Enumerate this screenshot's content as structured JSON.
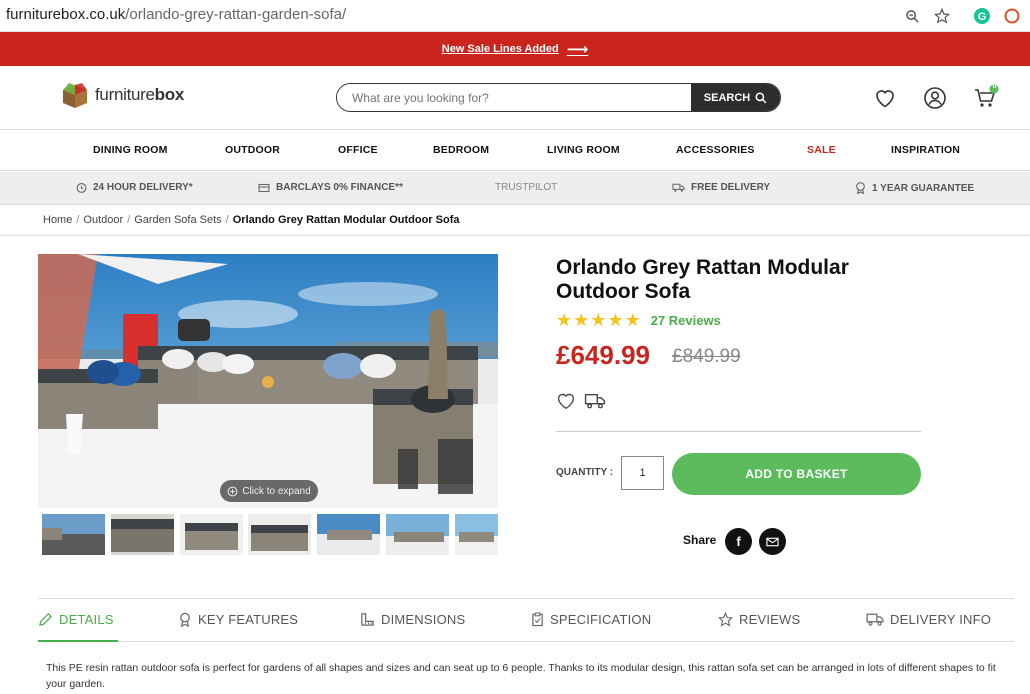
{
  "browser": {
    "url_domain": "furniturebox.co.uk",
    "url_path": "/orlando-grey-rattan-garden-sofa/"
  },
  "promo": {
    "text": "New Sale Lines Added"
  },
  "header": {
    "logo_light": "furniture",
    "logo_bold": "box",
    "search_placeholder": "What are you looking for?",
    "search_label": "SEARCH",
    "basket_count": "0"
  },
  "nav": [
    "DINING ROOM",
    "OUTDOOR",
    "OFFICE",
    "BEDROOM",
    "LIVING ROOM",
    "ACCESSORIES",
    "SALE",
    "INSPIRATION"
  ],
  "usp": [
    "24 HOUR DELIVERY*",
    "BARCLAYS 0% FINANCE**",
    "TRUSTPILOT",
    "FREE DELIVERY",
    "1 YEAR GUARANTEE"
  ],
  "breadcrumb": {
    "home": "Home",
    "outdoor": "Outdoor",
    "sets": "Garden Sofa Sets",
    "current": "Orlando Grey Rattan Modular Outdoor Sofa"
  },
  "gallery": {
    "expand_label": "Click to expand"
  },
  "product": {
    "title_line1": "Orlando Grey Rattan Modular",
    "title_line2": "Outdoor Sofa",
    "rating": 5,
    "reviews": "27 Reviews",
    "price": "£649.99",
    "old_price": "£849.99",
    "quantity_label": "QUANTITY :",
    "quantity": "1",
    "add_label": "ADD TO BASKET",
    "share_label": "Share"
  },
  "tabs": [
    "DETAILS",
    "KEY FEATURES",
    "DIMENSIONS",
    "SPECIFICATION",
    "REVIEWS",
    "DELIVERY INFO"
  ],
  "description": "This PE resin rattan outdoor sofa is perfect for gardens of all shapes and sizes and can seat up to 6 people. Thanks to its modular design, this rattan sofa set can be arranged in lots of different shapes to fit your garden.",
  "colors": {
    "brand_red": "#c9251d",
    "accent_green": "#5cbb5c",
    "rating_gold": "#f4c41e"
  }
}
